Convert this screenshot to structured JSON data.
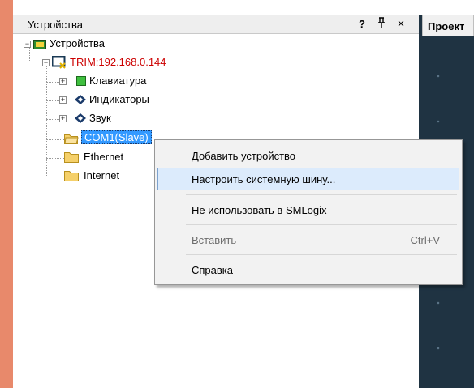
{
  "panel": {
    "title": "Устройства",
    "help_btn": "?",
    "pin_btn": "ᵖ",
    "close_btn": "×"
  },
  "right_dock": {
    "tab_label": "Проект"
  },
  "tree": {
    "root": "Устройства",
    "device": "TRIM:192.168.0.144",
    "keyboard": "Клавиатура",
    "indicators": "Индикаторы",
    "sound": "Звук",
    "com1": "COM1(Slave)",
    "ethernet": "Ethernet",
    "internet": "Internet"
  },
  "context_menu": {
    "add_device": "Добавить устройство",
    "configure_bus": "Настроить системную шину...",
    "dont_use": "Не использовать в SMLogix",
    "paste": "Вставить",
    "paste_shortcut": "Ctrl+V",
    "help": "Справка"
  },
  "colors": {
    "accent_strip": "#e8896b",
    "device_text": "#cc0000",
    "selection": "#3399ff",
    "menu_highlight": "#dcebfc",
    "dock_bg": "#1f3342"
  }
}
